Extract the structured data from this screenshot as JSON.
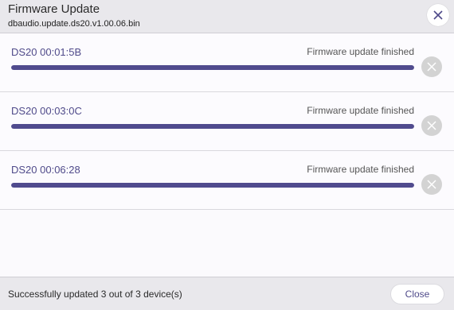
{
  "dialog": {
    "title": "Firmware Update",
    "filename": "dbaudio.update.ds20.v1.00.06.bin"
  },
  "devices": [
    {
      "name": "DS20 00:01:5B",
      "status": "Firmware update finished",
      "progress": 1.0
    },
    {
      "name": "DS20 00:03:0C",
      "status": "Firmware update finished",
      "progress": 1.0
    },
    {
      "name": "DS20 00:06:28",
      "status": "Firmware update finished",
      "progress": 1.0
    }
  ],
  "footer": {
    "summary": "Successfully updated 3 out of 3 device(s)",
    "close_label": "Close"
  },
  "colors": {
    "accent": "#504b8e",
    "device_text": "#4f4a8a",
    "remove_button": "#d3d3d3"
  }
}
